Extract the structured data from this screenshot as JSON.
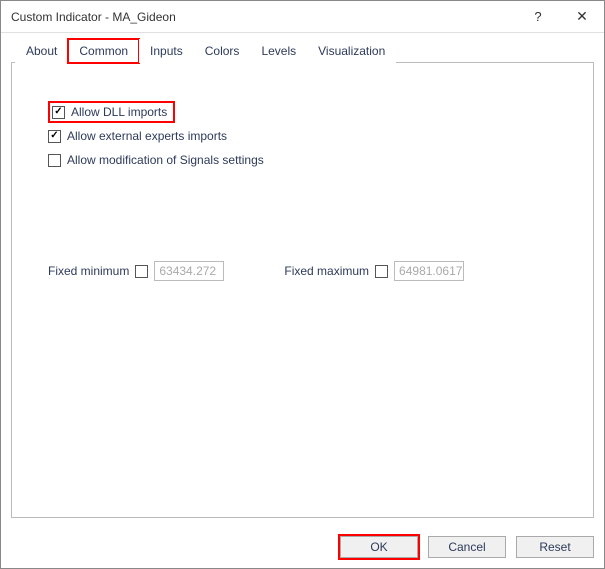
{
  "window": {
    "title": "Custom Indicator - MA_Gideon"
  },
  "tabs": {
    "about": "About",
    "common": "Common",
    "inputs": "Inputs",
    "colors": "Colors",
    "levels": "Levels",
    "visualization": "Visualization"
  },
  "checkboxes": {
    "allow_dll": {
      "label": "Allow DLL imports",
      "checked": true
    },
    "allow_experts": {
      "label": "Allow external experts imports",
      "checked": true
    },
    "allow_signals": {
      "label": "Allow modification of Signals settings",
      "checked": false
    }
  },
  "fixed": {
    "min_label": "Fixed minimum",
    "min_value": "63434.272",
    "max_label": "Fixed maximum",
    "max_value": "64981.0617"
  },
  "buttons": {
    "ok": "OK",
    "cancel": "Cancel",
    "reset": "Reset"
  }
}
